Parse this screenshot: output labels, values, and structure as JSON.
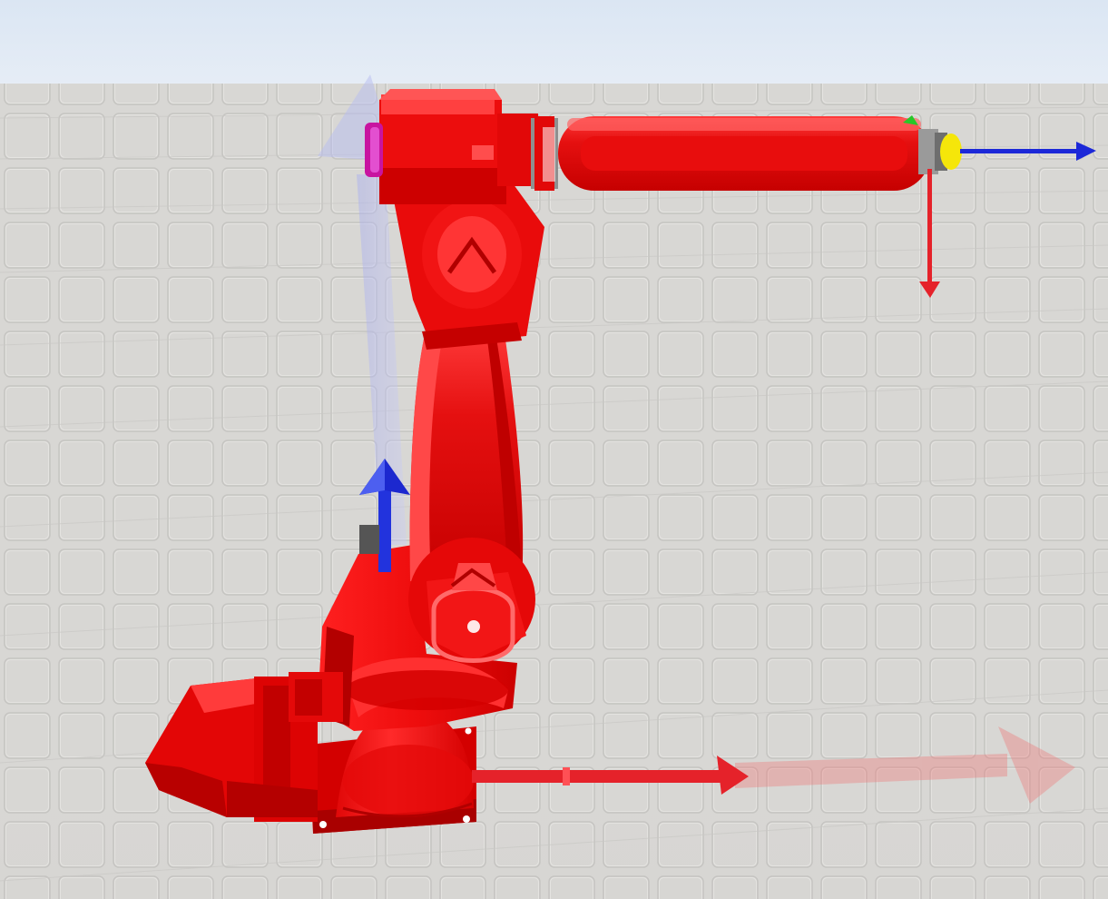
{
  "viewport": {
    "kind": "3d-robot-simulator-view",
    "sky_color": "#dde8f4",
    "floor_color": "#d7d6d3",
    "floor_grid_color": "#bdbcb9"
  },
  "robot": {
    "name": "industrial-6-axis-arm",
    "body_color": "#e80e0e",
    "body_shadow_color": "#b30000",
    "body_highlight_color": "#ff5c5c"
  },
  "gizmos": {
    "x_axis_color": "#e8242b",
    "z_axis_color": "#1e2ae0",
    "y_axis_color": "#28c828",
    "tool_tip_color": "#ffe620",
    "ghost_axis_opacity": 0.3
  },
  "icons": {
    "base-frame-x-arrow": "arrow-right",
    "base-frame-ghost-x-arrow": "arrow-right",
    "base-frame-z-arrow": "arrow-up",
    "base-frame-ghost-z-arrow": "arrow-up",
    "tool-frame-z-arrow": "arrow-right",
    "tool-frame-x-arrow": "arrow-down",
    "tool-frame-y-arrow": "arrow-up"
  }
}
